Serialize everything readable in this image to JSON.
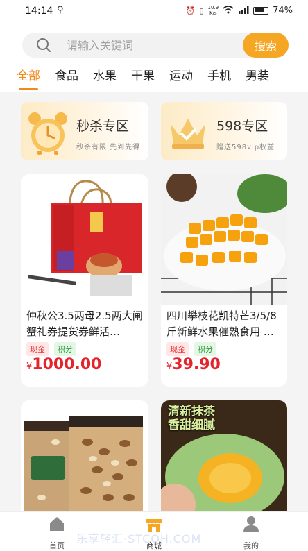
{
  "status": {
    "time": "14:14",
    "net_speed_top": "10.9",
    "net_speed_bottom": "K/s",
    "battery": "74%"
  },
  "search": {
    "placeholder": "请输入关键词",
    "button": "搜索"
  },
  "tabs": [
    {
      "label": "全部"
    },
    {
      "label": "食品"
    },
    {
      "label": "水果"
    },
    {
      "label": "干果"
    },
    {
      "label": "运动"
    },
    {
      "label": "手机"
    },
    {
      "label": "男装"
    }
  ],
  "promos": [
    {
      "title": "秒杀专区",
      "subtitle": "秒杀有限 先到先得"
    },
    {
      "title": "598专区",
      "subtitle": "赠送598vip权益"
    }
  ],
  "products": [
    {
      "name": "仲秋公3.5两母2.5两大闸蟹礼券提货券鲜活…",
      "tags": [
        "现金",
        "积分"
      ],
      "currency": "¥",
      "price": "1000.00"
    },
    {
      "name": "四川攀枝花凯特芒3/5/8斤新鲜水果催熟食用 …",
      "tags": [
        "现金",
        "积分"
      ],
      "currency": "¥",
      "price": "39.90"
    },
    {
      "name": "",
      "tags": [],
      "currency": "",
      "price": ""
    },
    {
      "name": "",
      "tags": [],
      "currency": "",
      "price": "",
      "image_text": [
        "清新抹茶",
        "香甜细腻"
      ]
    }
  ],
  "nav": [
    {
      "label": "首页"
    },
    {
      "label": "商城"
    },
    {
      "label": "我的"
    }
  ],
  "watermark": "乐享轻汇·STCQH.COM",
  "colors": {
    "accent": "#f5a623",
    "tab_active": "#f08a1c",
    "price": "#e4242b"
  }
}
